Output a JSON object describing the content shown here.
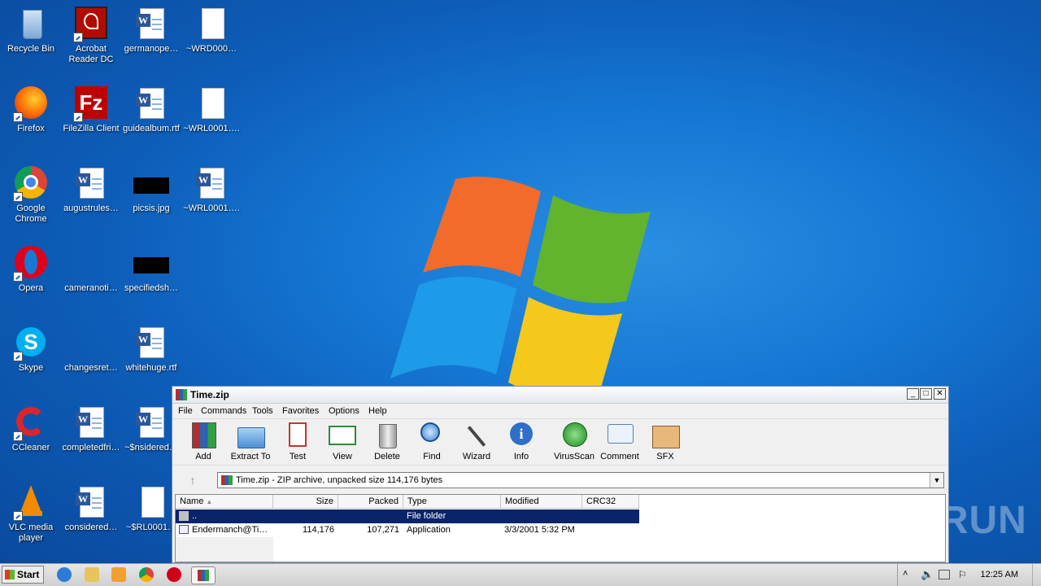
{
  "desktop": {
    "icons": [
      {
        "label": "Recycle Bin",
        "icon": "recycle-bin-icon"
      },
      {
        "label": "Acrobat Reader DC",
        "icon": "acrobat-icon"
      },
      {
        "label": "germanope…",
        "icon": "word-doc-icon"
      },
      {
        "label": "~WRD000…",
        "icon": "blank-file-icon"
      },
      {
        "label": "Firefox",
        "icon": "firefox-icon"
      },
      {
        "label": "FileZilla Client",
        "icon": "filezilla-icon"
      },
      {
        "label": "guidealbum.rtf",
        "icon": "word-doc-icon"
      },
      {
        "label": "~WRL0001….",
        "icon": "blank-file-icon"
      },
      {
        "label": "Google Chrome",
        "icon": "chrome-icon"
      },
      {
        "label": "augustrules…",
        "icon": "word-doc-icon"
      },
      {
        "label": "picsis.jpg",
        "icon": "image-file-icon"
      },
      {
        "label": "~WRL0001….",
        "icon": "word-doc-icon"
      },
      {
        "label": "Opera",
        "icon": "opera-icon"
      },
      {
        "label": "cameranoti…",
        "icon": "file-icon"
      },
      {
        "label": "specifiedsh…",
        "icon": "image-file-icon"
      },
      {
        "label": "Skype",
        "icon": "skype-icon"
      },
      {
        "label": "changesret…",
        "icon": "file-icon"
      },
      {
        "label": "whitehuge.rtf",
        "icon": "word-doc-icon"
      },
      {
        "label": "CCleaner",
        "icon": "ccleaner-icon"
      },
      {
        "label": "completedfri…",
        "icon": "word-doc-icon"
      },
      {
        "label": "~$nsidered…",
        "icon": "word-doc-icon"
      },
      {
        "label": "VLC media player",
        "icon": "vlc-icon"
      },
      {
        "label": "considered…",
        "icon": "word-doc-icon"
      },
      {
        "label": "~$RL0001…",
        "icon": "blank-file-icon"
      }
    ]
  },
  "window": {
    "title": "Time.zip",
    "menu": [
      "File",
      "Commands",
      "Tools",
      "Favorites",
      "Options",
      "Help"
    ],
    "toolbar": [
      "Add",
      "Extract To",
      "Test",
      "View",
      "Delete",
      "Find",
      "Wizard",
      "Info",
      "VirusScan",
      "Comment",
      "SFX"
    ],
    "address": "Time.zip - ZIP archive, unpacked size 114,176 bytes",
    "columns": [
      "Name",
      "Size",
      "Packed",
      "Type",
      "Modified",
      "CRC32"
    ],
    "rows": [
      {
        "name": "..",
        "size": "",
        "packed": "",
        "type": "File folder",
        "modified": "",
        "crc": ""
      },
      {
        "name": "Endermanch@Ti…",
        "size": "114,176",
        "packed": "107,271",
        "type": "Application",
        "modified": "3/3/2001 5:32 PM",
        "crc": ""
      }
    ]
  },
  "watermark": "ANY RUN",
  "taskbar": {
    "start_label": "Start",
    "clock": "12:25 AM"
  },
  "colors": {
    "selection": "#0a246a",
    "desktop": "#1679d6"
  }
}
